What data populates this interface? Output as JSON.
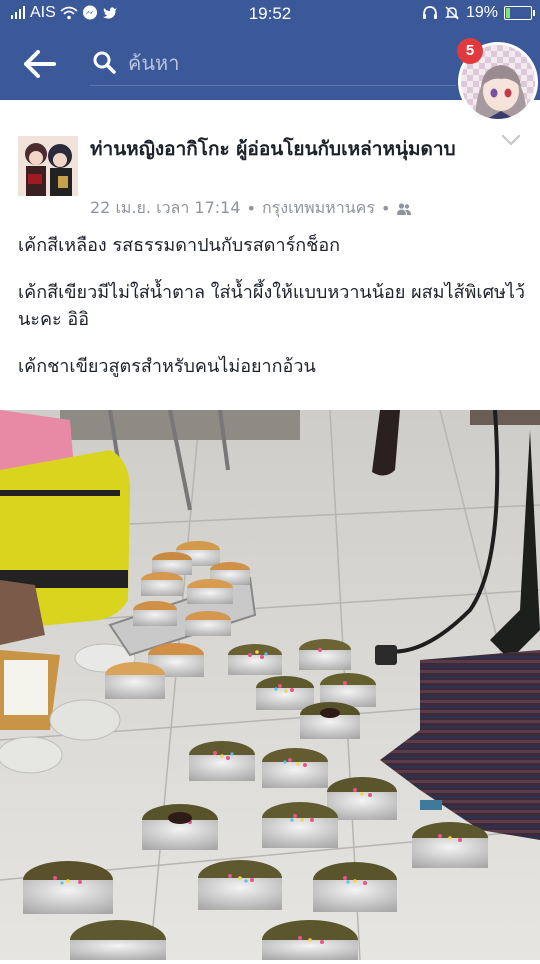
{
  "status_bar": {
    "carrier": "AIS",
    "time": "19:52",
    "battery": "19%",
    "battery_level": 0.19
  },
  "search": {
    "placeholder": "ค้นหา"
  },
  "notifications": {
    "count": "5"
  },
  "post": {
    "author": "ท่านหญิงอากิโกะ ผู้อ่อนโยนกับเหล่าหนุ่มดาบ",
    "date": "22 เม.ย. เวลา 17:14",
    "separator": "•",
    "location": "กรุงเทพมหานคร",
    "separator2": "•",
    "paragraphs": [
      "เค้กสีเหลือง รสธรรมดาปนกับรสดาร์กช็อก",
      "เค้กสีเขียวมีไม่ใส่น้ำตาล ใส่น้ำผึ้งให้แบบหวานน้อย ผสมไส้พิเศษไว้นะคะ อิอิ",
      "เค้กชาเขียวสูตรสำหรับคนไม่อยากอ้วน"
    ]
  },
  "icons": {
    "back": "back-arrow-icon",
    "search": "search-icon",
    "audience": "friends-icon",
    "more": "chevron-down-icon"
  },
  "colors": {
    "facebook_blue": "#3b5998",
    "badge_red": "#e0393e",
    "meta_gray": "#90949c"
  }
}
